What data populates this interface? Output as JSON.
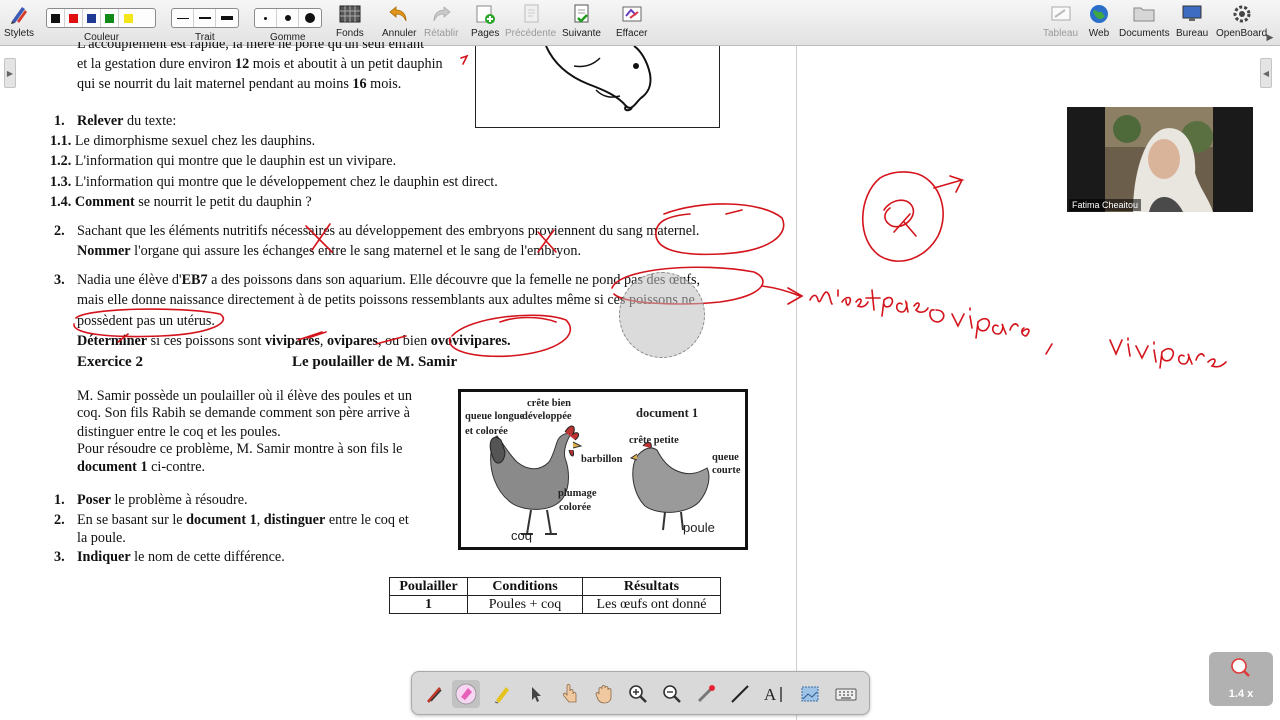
{
  "toolbar": {
    "stylets": "Stylets",
    "couleur": "Couleur",
    "trait": "Trait",
    "gomme": "Gomme",
    "fonds": "Fonds",
    "annuler": "Annuler",
    "retablir": "Rétablir",
    "pages": "Pages",
    "precedente": "Précédente",
    "suivante": "Suivante",
    "effacer": "Effacer",
    "tableau": "Tableau",
    "web": "Web",
    "documents": "Documents",
    "bureau": "Bureau",
    "openboard": "OpenBoard",
    "colors": [
      "#111111",
      "#e01010",
      "#1f3a93",
      "#118a1a",
      "#f4e61a"
    ]
  },
  "doc": {
    "l1": "L'accouplement est rapide, la mère ne porte qu'un seul enfant",
    "l2a": "et la gestation dure environ ",
    "l2b": "12",
    "l2c": " mois et aboutit à un petit dauphin",
    "l3a": "qui se nourrit du lait maternel pendant au moins ",
    "l3b": "16",
    "l3c": " mois.",
    "q1_num": "1.",
    "q1_bold": "Relever",
    "q1_rest": " du texte:",
    "q11_num": "1.1.",
    "q11": " Le dimorphisme sexuel chez les dauphins.",
    "q12_num": "1.2.",
    "q12": " L'information qui montre que le dauphin est un vivipare.",
    "q13_num": "1.3.",
    "q13": " L'information qui montre que le développement chez le dauphin est direct.",
    "q14_num": "1.4.",
    "q14_bold": "Comment",
    "q14_rest": " se nourrit le petit du dauphin ?",
    "q2_num": "2.",
    "q2_l1": "Sachant que les éléments nutritifs nécessaires au développement des embryons proviennent du sang maternel.",
    "q2_bold": "Nommer",
    "q2_l2": " l'organe qui assure les échanges entre le sang maternel et le sang de l'embryon.",
    "q3_num": "3.",
    "q3_l1a": "Nadia une élève d'",
    "q3_l1b": "EB7",
    "q3_l1c": " a des poissons dans son aquarium. Elle découvre que la femelle ne pond pas des œufs,",
    "q3_l2": "mais elle donne naissance directement à de petits poissons ressemblants aux adultes même si ces poissons ne",
    "q3_l3": "possèdent pas un utérus.",
    "q3_bold": "Déterminer",
    "q3_l4a": " si ces poissons sont ",
    "q3_v1": "vivipares",
    "q3_sep1": ", ",
    "q3_v2": "ovipares",
    "q3_sep2": ", ou bien ",
    "q3_v3": "ovovivipares.",
    "ex2": "Exercice 2",
    "ex2_title": "Le poulailler de M. Samir",
    "p1": "M. Samir possède un poulailler où il élève des poules et un",
    "p2": "coq. Son fils Rabih se demande comment son père arrive à",
    "p3": "distinguer entre le coq et les poules.",
    "p4": "Pour résoudre ce problème, M. Samir montre à son fils le",
    "p5": "document 1",
    "p5b": " ci-contre.",
    "e1_num": "1.",
    "e1_bold": "Poser",
    "e1_rest": " le problème à résoudre.",
    "e2_num": "2.",
    "e2a": "En se basant sur le ",
    "e2b": "document 1",
    "e2c": ", ",
    "e2d": "distinguer",
    "e2e": " entre le coq et",
    "e2f": "la poule.",
    "e3_num": "3.",
    "e3_bold": "Indiquer",
    "e3_rest": " le nom de cette différence."
  },
  "figure": {
    "title": "document 1",
    "queue_longue": "queue longue",
    "et_coloree": "et colorée",
    "crete_bien": "crête bien",
    "developpee": "développée",
    "barbillon": "barbillon",
    "plumage": "plumage",
    "coloree": "colorée",
    "crete_petite": "crête petite",
    "queue": "queue",
    "courte": "courte",
    "coq": "coq",
    "poule": "poule"
  },
  "table": {
    "headers": [
      "Poulailler",
      "Conditions",
      "Résultats"
    ],
    "row1": [
      "1",
      "Poules + coq",
      "Les œufs ont donné"
    ]
  },
  "annotations": {
    "hand1": "n'est pas ovipare",
    "hand2": "vivipare",
    "comma": ","
  },
  "webcam": {
    "name": "Fatima Cheaitou"
  },
  "zoom": "1.4 x"
}
